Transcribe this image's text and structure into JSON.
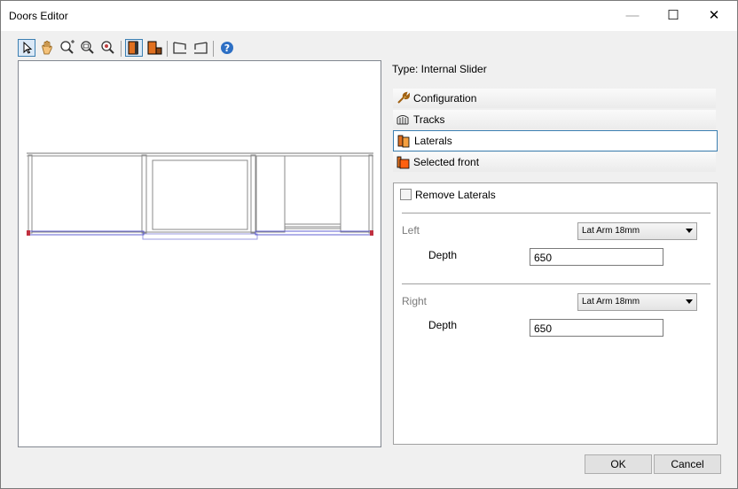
{
  "window": {
    "title": "Doors Editor"
  },
  "type_label": "Type: Internal Slider",
  "sections": [
    {
      "label": "Configuration"
    },
    {
      "label": "Tracks"
    },
    {
      "label": "Laterals"
    },
    {
      "label": "Selected front"
    }
  ],
  "laterals": {
    "remove_label": "Remove Laterals",
    "left": {
      "label": "Left",
      "select_value": "Lat Arm 18mm",
      "depth_label": "Depth",
      "depth_value": "650"
    },
    "right": {
      "label": "Right",
      "select_value": "Lat Arm 18mm",
      "depth_label": "Depth",
      "depth_value": "650"
    }
  },
  "buttons": {
    "ok": "OK",
    "cancel": "Cancel"
  },
  "toolbar": [
    "pointer-icon",
    "pan-icon",
    "zoom-in-icon",
    "zoom-window-icon",
    "zoom-extents-icon",
    "door-front-view-icon",
    "door-side-view-icon",
    "perspective-left-icon",
    "perspective-right-icon",
    "help-icon"
  ]
}
